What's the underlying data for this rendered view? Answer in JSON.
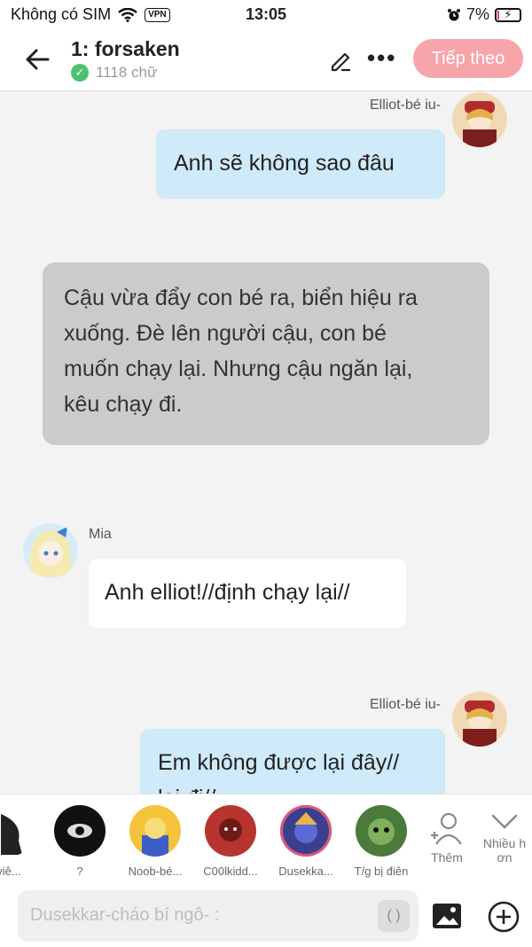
{
  "status": {
    "carrier": "Không có SIM",
    "vpn": "VPN",
    "time": "13:05",
    "battery": "7%",
    "battery_level": 0.07
  },
  "header": {
    "title": "1: forsaken",
    "word_count": "1118 chữ",
    "next_label": "Tiếp theo"
  },
  "messages": [
    {
      "sender": "Elliot-bé iu-",
      "text": "Anh sẽ không sao đâu"
    },
    {
      "text_lines": [
        "Cậu vừa đẩy con bé ra, biển hiệu ra",
        "xuống. Đè lên người cậu, con bé",
        "muốn chạy lại. Nhưng cậu ngăn lại,",
        "kêu chạy đi."
      ]
    },
    {
      "sender": "Mia",
      "text": "Anh elliot!//định chạy lại//"
    },
    {
      "sender": "Elliot-bé iu-",
      "text": "Em không được lại đây//",
      "text_partial": "lại đi//"
    }
  ],
  "characters": [
    {
      "label": "viê...",
      "color": "#333"
    },
    {
      "label": "?",
      "color": "#111"
    },
    {
      "label": "Noob-bé...",
      "color": "#f4c33b"
    },
    {
      "label": "C00lkidd...",
      "color": "#b7352e"
    },
    {
      "label": "Dusekka...",
      "color": "#3a3f8f"
    },
    {
      "label": "T/g bị điên",
      "color": "#4b7a3a"
    }
  ],
  "actions": {
    "add_label": "Thêm",
    "more_label_1": "Nhiều h",
    "more_label_2": "ơn"
  },
  "composer": {
    "placeholder": "Dusekkar-cháo bí ngô- :",
    "paren": "( )"
  }
}
